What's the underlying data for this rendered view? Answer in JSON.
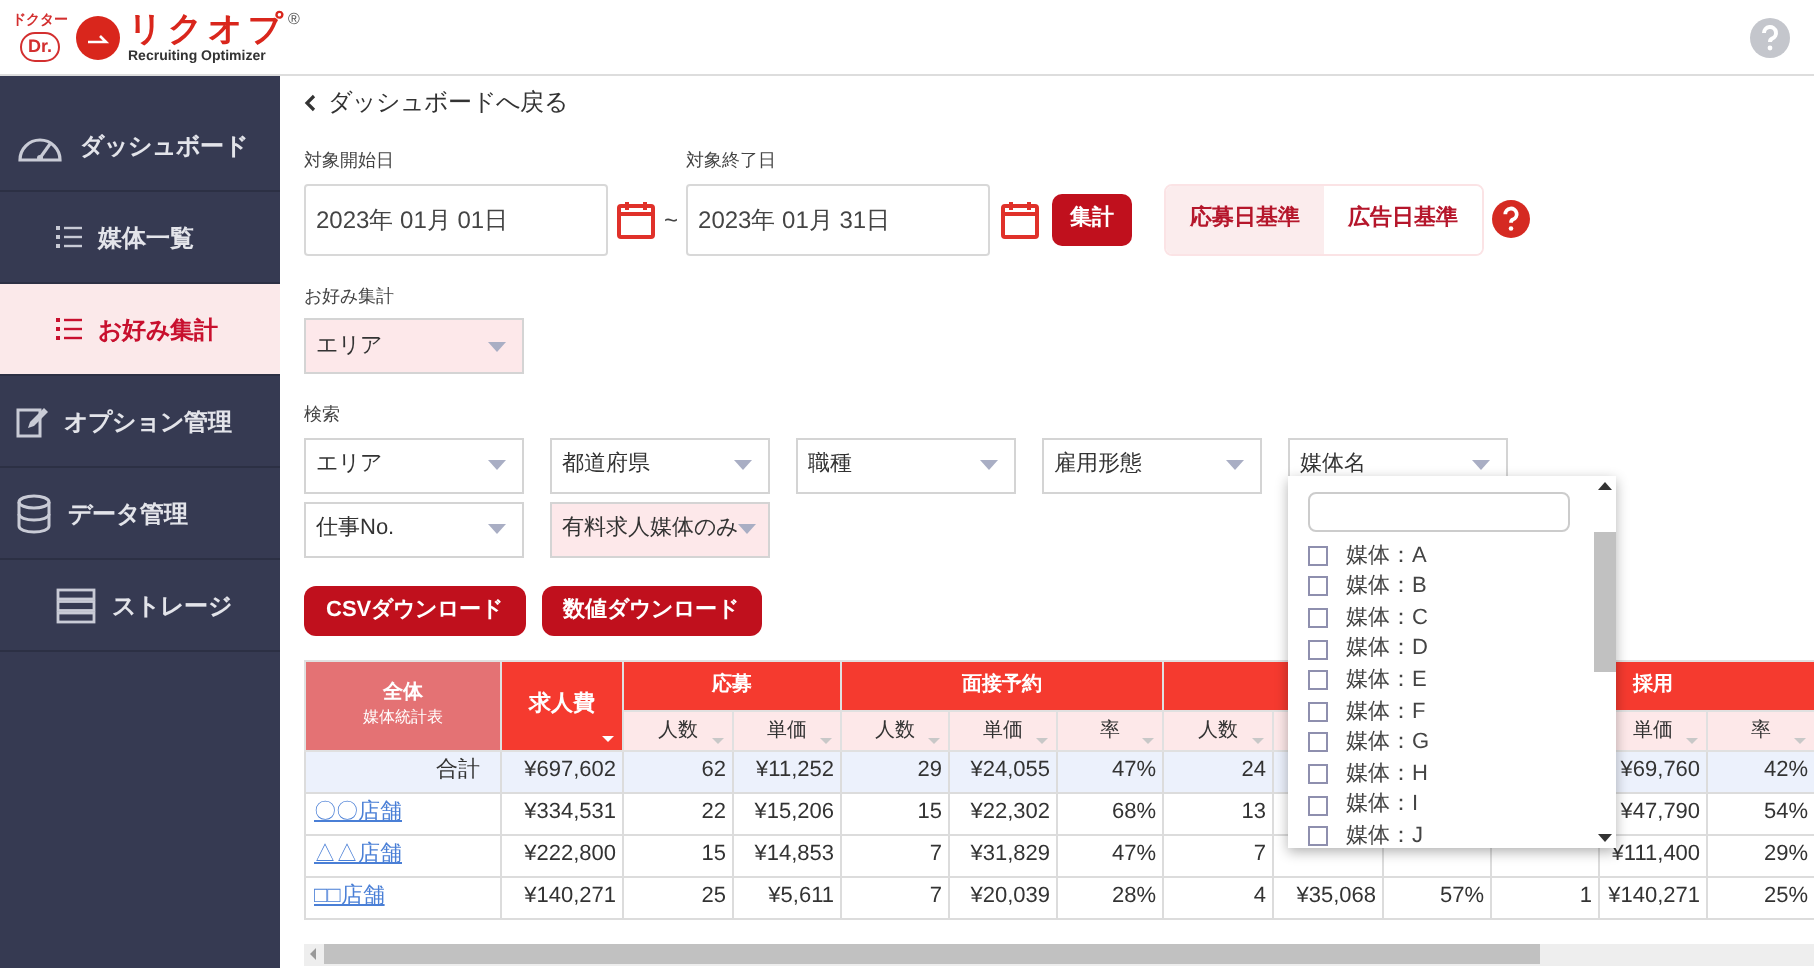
{
  "logo": {
    "tagline": "ドクター",
    "badge": "Dr.",
    "name": "リクオプ",
    "registered": "®",
    "subtitle": "Recruiting Optimizer"
  },
  "sidebar": {
    "items": [
      {
        "label": "ダッシュボード",
        "kind": "gauge",
        "selected": false,
        "children": [
          {
            "label": "媒体一覧",
            "kind": "list",
            "selected": false
          },
          {
            "label": "お好み集計",
            "kind": "list",
            "selected": true
          }
        ]
      },
      {
        "label": "オプション管理",
        "kind": "edit",
        "selected": false
      },
      {
        "label": "データ管理",
        "kind": "database",
        "selected": false,
        "children": [
          {
            "label": "ストレージ",
            "kind": "storage",
            "selected": false
          }
        ]
      }
    ]
  },
  "back_link": "ダッシュボードへ戻る",
  "date_range": {
    "start": {
      "label": "対象開始日",
      "value": "2023年 01月 01日"
    },
    "separator": "~",
    "end": {
      "label": "対象終了日",
      "value": "2023年 01月 31日"
    },
    "submit": "集計"
  },
  "basis_toggle": [
    {
      "label": "応募日基準",
      "selected": true
    },
    {
      "label": "広告日基準",
      "selected": false
    }
  ],
  "favorite": {
    "label": "お好み集計",
    "value": "エリア",
    "active": true
  },
  "search": {
    "label": "検索",
    "filters": [
      {
        "value": "エリア",
        "active": false
      },
      {
        "value": "都道府県",
        "active": false
      },
      {
        "value": "職種",
        "active": false
      },
      {
        "value": "雇用形態",
        "active": false
      },
      {
        "value": "媒体名",
        "active": false
      },
      {
        "value": "仕事No.",
        "active": false
      },
      {
        "value": "有料求人媒体のみ",
        "active": true
      }
    ]
  },
  "buttons": [
    "CSVダウンロード",
    "数値ダウンロード"
  ],
  "media_dropdown": {
    "items": [
      {
        "label": "媒体：A",
        "checked": false
      },
      {
        "label": "媒体：B",
        "checked": false
      },
      {
        "label": "媒体：C",
        "checked": false
      },
      {
        "label": "媒体：D",
        "checked": false
      },
      {
        "label": "媒体：E",
        "checked": false
      },
      {
        "label": "媒体：F",
        "checked": false
      },
      {
        "label": "媒体：G",
        "checked": false
      },
      {
        "label": "媒体：H",
        "checked": false
      },
      {
        "label": "媒体：I",
        "checked": false
      },
      {
        "label": "媒体：J",
        "checked": false
      }
    ]
  },
  "table": {
    "corner": {
      "label": "全体",
      "sublabel": "媒体統計表"
    },
    "cost_header": "求人費",
    "groups": [
      {
        "label": "応募",
        "columns": [
          "人数",
          "単価"
        ]
      },
      {
        "label": "面接予約",
        "columns": [
          "人数",
          "単価",
          "率"
        ]
      },
      {
        "columns": [
          "人数",
          null,
          null
        ]
      },
      {
        "label": "採用",
        "columns": [
          null,
          "単価",
          "率"
        ]
      }
    ],
    "rows": [
      {
        "label": "合計",
        "kind": "total",
        "cells": [
          "¥697,602",
          "62",
          "¥11,252",
          "29",
          "¥24,055",
          "47%",
          "24",
          null,
          null,
          null,
          "¥69,760",
          "42%"
        ]
      },
      {
        "label": "〇〇店舗",
        "kind": "link",
        "cells": [
          "¥334,531",
          "22",
          "¥15,206",
          "15",
          "¥22,302",
          "68%",
          "13",
          null,
          null,
          null,
          "¥47,790",
          "54%"
        ]
      },
      {
        "label": "△△店舗",
        "kind": "link",
        "cells": [
          "¥222,800",
          "15",
          "¥14,853",
          "7",
          "¥31,829",
          "47%",
          "7",
          null,
          null,
          null,
          "¥111,400",
          "29%"
        ]
      },
      {
        "label": "□□店舗",
        "kind": "link",
        "cells": [
          "¥140,271",
          "25",
          "¥5,611",
          "7",
          "¥20,039",
          "28%",
          "4",
          "¥35,068",
          "57%",
          "1",
          "¥140,271",
          "25%"
        ]
      }
    ]
  }
}
